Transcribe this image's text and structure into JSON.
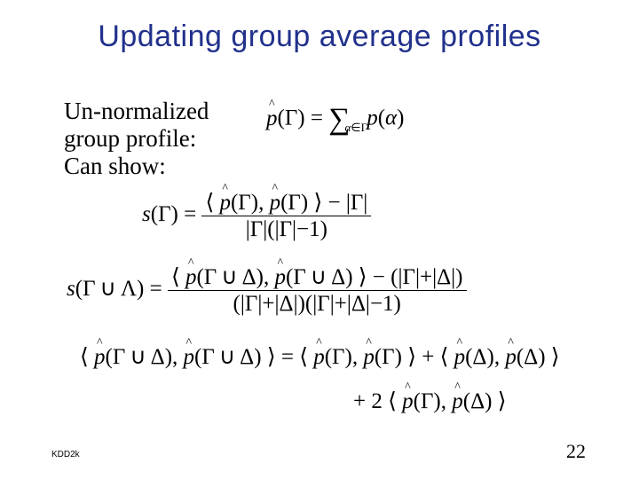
{
  "title": "Updating group average profiles",
  "intro_line1": "Un-normalized",
  "intro_line2": "group profile:",
  "intro_line3": "Can show:",
  "sym": {
    "p": "p",
    "s": "s",
    "gamma": "Γ",
    "delta": "Δ",
    "lambda": "Λ",
    "alpha": "α",
    "in": "∈",
    "cup": "∪",
    "eq": "=",
    "minus": "−",
    "plus": "+",
    "lp": "(",
    "rp": ")",
    "la": "⟨",
    "ra": "⟩",
    "bar": "|",
    "one": "1",
    "two": "2",
    "comma": ",",
    "hat": "^"
  },
  "footer": {
    "left": "KDD2k",
    "right": "22"
  }
}
